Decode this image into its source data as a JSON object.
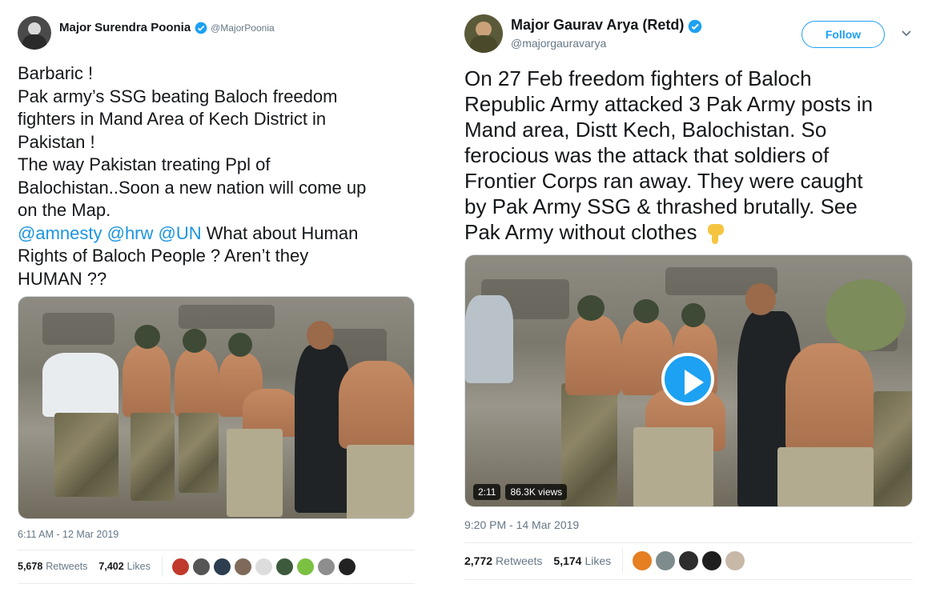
{
  "left_tweet": {
    "display_name": "Major Surendra Poonia",
    "handle": "@MajorPoonia",
    "text_lines": [
      "Barbaric !",
      "Pak army’s SSG beating Baloch freedom",
      "fighters in Mand Area of Kech District in",
      "Pakistan !",
      "The way Pakistan treating Ppl of",
      "Balochistan..Soon a new nation will come up",
      "on the Map."
    ],
    "mentions": [
      "@amnesty",
      "@hrw",
      "@UN"
    ],
    "text_after_mentions": " What about Human",
    "text_tail_lines": [
      "Rights of Baloch People ? Aren’t they",
      "HUMAN ??"
    ],
    "timestamp": "6:11 AM - 12 Mar 2019",
    "retweets_count": "5,678",
    "retweets_label": "Retweets",
    "likes_count": "7,402",
    "likes_label": "Likes",
    "liker_colors": [
      "#c0392b",
      "#555555",
      "#2c3e50",
      "#7f6a5a",
      "#dddddd",
      "#3d5a3d",
      "#7bc043",
      "#8e8e8e",
      "#222222"
    ]
  },
  "right_tweet": {
    "display_name": "Major Gaurav Arya (Retd)",
    "handle": "@majorgauravarya",
    "follow_label": "Follow",
    "text_lines": [
      "On 27 Feb freedom fighters of Baloch",
      "Republic Army attacked 3 Pak Army posts in",
      "Mand area, Distt Kech, Balochistan. So",
      "ferocious was the attack that soldiers of",
      "Frontier Corps ran away. They were caught",
      "by Pak Army SSG & thrashed brutally. See",
      "Pak Army without clothes"
    ],
    "video_duration": "2:11",
    "video_views": "86.3K views",
    "timestamp": "9:20 PM - 14 Mar 2019",
    "retweets_count": "2,772",
    "retweets_label": "Retweets",
    "likes_count": "5,174",
    "likes_label": "Likes",
    "liker_colors": [
      "#e67e22",
      "#7f8c8d",
      "#2d2d2d",
      "#1e1e1e",
      "#c8b8a8"
    ]
  }
}
